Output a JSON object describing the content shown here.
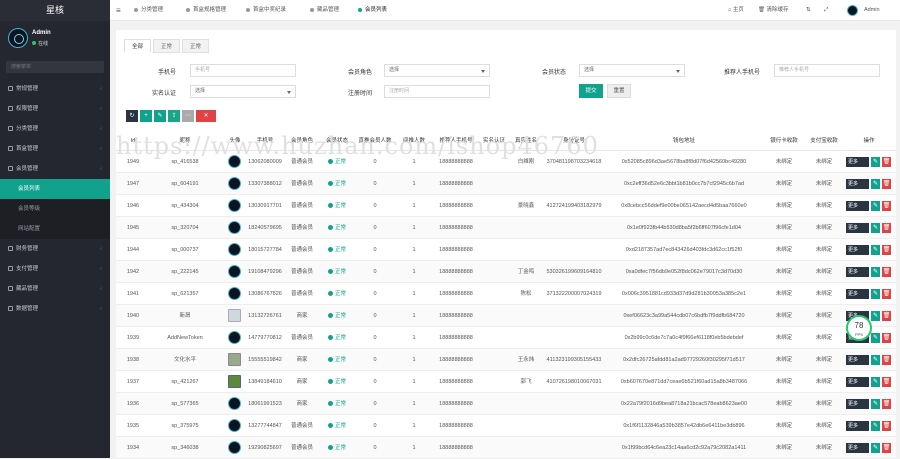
{
  "brand": "星核",
  "user": {
    "name": "Admin",
    "status": "在线"
  },
  "search_placeholder": "搜索菜单",
  "sidebar": [
    {
      "type": "group",
      "label": "常规管理",
      "icon": "gear-icon"
    },
    {
      "type": "group",
      "label": "权限管理",
      "icon": "users-icon"
    },
    {
      "type": "group",
      "label": "分类管理",
      "icon": "list-icon"
    },
    {
      "type": "group",
      "label": "首盒管理",
      "icon": "box-icon"
    },
    {
      "type": "group",
      "label": "会员管理",
      "icon": "user-icon"
    },
    {
      "type": "sub",
      "label": "会员列表",
      "active": true
    },
    {
      "type": "sub",
      "label": "会员等级"
    },
    {
      "type": "sub",
      "label": "网站配置"
    },
    {
      "type": "group",
      "label": "财务管理",
      "icon": "money-icon"
    },
    {
      "type": "group",
      "label": "支付管理",
      "icon": "card-icon"
    },
    {
      "type": "group",
      "label": "藏品管理",
      "icon": "gem-icon"
    },
    {
      "type": "group",
      "label": "数据管理",
      "icon": "chart-icon"
    }
  ],
  "topbar": {
    "tabs": [
      "分类管理",
      "首盒规格管理",
      "首盒中奖纪录",
      "藏品管理",
      "会员列表"
    ],
    "home": "主页",
    "clear_cache": "清除缓存",
    "admin": "Admin"
  },
  "subtabs": [
    "全部",
    "正常",
    "正常"
  ],
  "filters": {
    "phone_label": "手机号",
    "phone_placeholder": "手机号",
    "role_label": "会员角色",
    "role_value": "选择",
    "status_label": "会员状态",
    "status_value": "选择",
    "ref_phone_label": "推荐人手机号",
    "ref_phone_placeholder": "推荐人手机号",
    "realname_label": "实名认证",
    "realname_value": "选择",
    "regtime_label": "注册时间",
    "regtime_placeholder": "注册时间",
    "submit": "提交",
    "reset": "重置"
  },
  "watermark": "https://www.huzhan.com/ishop46760",
  "table": {
    "headers": [
      "Id",
      "昵称",
      "头像",
      "手机号",
      "会员角色",
      "会员状态",
      "直推会员人数",
      "间推人数",
      "推荐人手机号",
      "实名认证",
      "真实姓名",
      "身份证号",
      "钱包地址",
      "银行卡收款",
      "支付宝收款",
      "操作"
    ],
    "rows": [
      {
        "id": "1949",
        "nick": "sp_416538",
        "avatar": "logo",
        "phone": "13062080009",
        "role": "普通会员",
        "status": "正常",
        "direct": "0",
        "indirect": "1",
        "ref": "18888888888",
        "real": "",
        "name": "白维刚",
        "idno": "370481198703234618",
        "wallet": "0x52085c896d3ae5678ba8f8d07f6d42560bc49280",
        "bank": "未绑定",
        "alipay": "未绑定"
      },
      {
        "id": "1947",
        "nick": "sp_604191",
        "avatar": "logo",
        "phone": "13307388012",
        "role": "普通会员",
        "status": "正常",
        "direct": "0",
        "indirect": "1",
        "ref": "18888888888",
        "real": "",
        "name": "",
        "idno": "",
        "wallet": "0xc2eff36d52e6c3bbt1b81b0cc7b7cf2945c6b7ad",
        "bank": "未绑定",
        "alipay": "未绑定"
      },
      {
        "id": "1946",
        "nick": "sp_434304",
        "avatar": "logo",
        "phone": "13030917701",
        "role": "普通会员",
        "status": "正常",
        "direct": "0",
        "indirect": "1",
        "ref": "18888888888",
        "real": "",
        "name": "景晓鑫",
        "idno": "412724199403182979",
        "wallet": "0x8cebcc56ddef9e00be065142aecd4d5baa7660e0",
        "bank": "未绑定",
        "alipay": "未绑定"
      },
      {
        "id": "1945",
        "nick": "sp_320704",
        "avatar": "logo",
        "phone": "18240579695",
        "role": "普通会员",
        "status": "正常",
        "direct": "0",
        "indirect": "1",
        "ref": "18888888888",
        "real": "",
        "name": "",
        "idno": "",
        "wallet": "0x1e0f923fb44b530d8ba5f2b6ff607f96cfe1d04",
        "bank": "未绑定",
        "alipay": "未绑定"
      },
      {
        "id": "1944",
        "nick": "sp_000737",
        "avatar": "logo",
        "phone": "18015727784",
        "role": "普通会员",
        "status": "正常",
        "direct": "0",
        "indirect": "1",
        "ref": "18888888888",
        "real": "",
        "name": "",
        "idno": "",
        "wallet": "0xd2187357ad7ec843426d403fdc3d62cc1f52f0",
        "bank": "未绑定",
        "alipay": "未绑定"
      },
      {
        "id": "1942",
        "nick": "sp_222145",
        "avatar": "logo",
        "phone": "19108479296",
        "role": "普通会员",
        "status": "正常",
        "direct": "0",
        "indirect": "1",
        "ref": "18888888888",
        "real": "",
        "name": "丁金鸣",
        "idno": "530326199609164810",
        "wallet": "0xa0dfec7f56db9e052f8dc062e79017c3d70d30",
        "bank": "未绑定",
        "alipay": "未绑定"
      },
      {
        "id": "1941",
        "nick": "sp_621357",
        "avatar": "logo",
        "phone": "13086767826",
        "role": "普通会员",
        "status": "正常",
        "direct": "0",
        "indirect": "1",
        "ref": "18888888888",
        "real": "",
        "name": "陈松",
        "idno": "371322200007024319",
        "wallet": "0x006c3951881cd933d37d9d281b30053a385c2e1",
        "bank": "未绑定",
        "alipay": "未绑定"
      },
      {
        "id": "1940",
        "nick": "新昂",
        "avatar": "ph",
        "phone": "13132726761",
        "role": "商家",
        "status": "正常",
        "direct": "0",
        "indirect": "1",
        "ref": "18888888888",
        "real": "",
        "name": "",
        "idno": "",
        "wallet": "0xef06623c3a99a544cdb07c6bdfb7f9ddfb684720",
        "bank": "未绑定",
        "alipay": "未绑定"
      },
      {
        "id": "1939",
        "nick": "AddNewToken",
        "avatar": "logo",
        "phone": "14779770812",
        "role": "普通会员",
        "status": "正常",
        "direct": "0",
        "indirect": "1",
        "ref": "18888888888",
        "real": "",
        "name": "",
        "idno": "",
        "wallet": "0x2b99c0c6de7c7a0c4f9f66ef6118f0eb5bdebdef",
        "bank": "未绑定",
        "alipay": "未绑定"
      },
      {
        "id": "1938",
        "nick": "文化水平",
        "avatar": "ph2",
        "phone": "15555519842",
        "role": "商家",
        "status": "正常",
        "direct": "0",
        "indirect": "1",
        "ref": "18888888888",
        "real": "",
        "name": "王永炜",
        "idno": "411323199305155433",
        "wallet": "0x2dfc26725afdd81a2ad97729260f30295f71d517",
        "bank": "未绑定",
        "alipay": "未绑定"
      },
      {
        "id": "1937",
        "nick": "sp_421267",
        "avatar": "ph3",
        "phone": "13849184610",
        "role": "商家",
        "status": "正常",
        "direct": "0",
        "indirect": "1",
        "ref": "18888888888",
        "real": "",
        "name": "郭飞",
        "idno": "410726198010067031",
        "wallet": "0xb607670e871dd7ceae6b521f60ad15a8b3487066",
        "bank": "未绑定",
        "alipay": "未绑定"
      },
      {
        "id": "1936",
        "nick": "sp_577365",
        "avatar": "logo",
        "phone": "18061991523",
        "role": "商家",
        "status": "正常",
        "direct": "0",
        "indirect": "1",
        "ref": "18888888888",
        "real": "",
        "name": "",
        "idno": "",
        "wallet": "0x22a79f2016d9bea8718a21bcac578eab8623ae00",
        "bank": "未绑定",
        "alipay": "未绑定"
      },
      {
        "id": "1935",
        "nick": "sp_375975",
        "avatar": "logo",
        "phone": "13277744847",
        "role": "普通会员",
        "status": "正常",
        "direct": "0",
        "indirect": "1",
        "ref": "18888888888",
        "real": "",
        "name": "",
        "idno": "",
        "wallet": "0x1f6f1132846a539b3857e42db6e6411be3db896",
        "bank": "未绑定",
        "alipay": "未绑定"
      },
      {
        "id": "1934",
        "nick": "sp_346038",
        "avatar": "logo",
        "phone": "19290825697",
        "role": "普通会员",
        "status": "正常",
        "direct": "0",
        "indirect": "1",
        "ref": "18888888888",
        "real": "",
        "name": "",
        "idno": "",
        "wallet": "0x1f99bcd64c6ea23c14aa6cd2c92a79c2082a1411",
        "bank": "未绑定",
        "alipay": "未绑定"
      }
    ],
    "op_more": "更多"
  },
  "fps": {
    "value": "78",
    "unit": "FPS"
  }
}
